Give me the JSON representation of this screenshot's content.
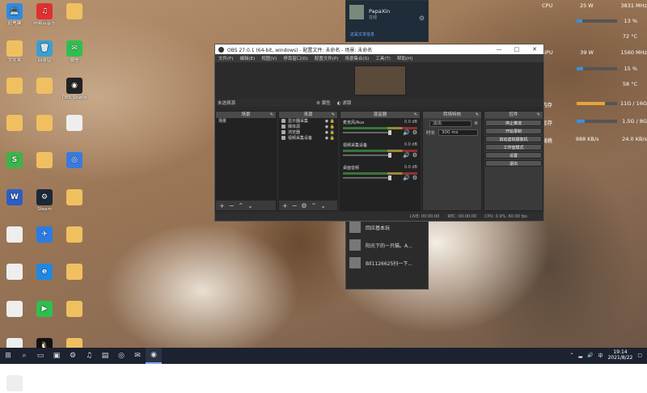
{
  "desktop": {
    "icons": [
      {
        "label": "此电脑",
        "color": "#2e8be6",
        "glyph": "💻",
        "name": "this-pc"
      },
      {
        "label": "网易云音乐",
        "color": "#e03030",
        "glyph": "♫",
        "name": "netease-music"
      },
      {
        "label": "",
        "color": "#f0c060",
        "glyph": "",
        "name": "folder"
      },
      {
        "label": "文件夹",
        "color": "#f0c060",
        "glyph": "",
        "name": "folder"
      },
      {
        "label": "回收站",
        "color": "#3aa0d0",
        "glyph": "🗑",
        "name": "recycle-bin"
      },
      {
        "label": "微信",
        "color": "#2fbf4f",
        "glyph": "✉",
        "name": "wechat"
      },
      {
        "label": "",
        "color": "#f0c060",
        "glyph": "",
        "name": "folder"
      },
      {
        "label": "",
        "color": "#f0c060",
        "glyph": "",
        "name": "folder"
      },
      {
        "label": "OBS Studio",
        "color": "#222",
        "glyph": "◉",
        "name": "obs-studio"
      },
      {
        "label": "",
        "color": "#f0c060",
        "glyph": "",
        "name": "folder"
      },
      {
        "label": "",
        "color": "#f0c060",
        "glyph": "",
        "name": "folder"
      },
      {
        "label": "",
        "color": "#eeeeee",
        "glyph": "",
        "name": "file"
      },
      {
        "label": "",
        "color": "#3bb54a",
        "glyph": "S",
        "name": "app"
      },
      {
        "label": "",
        "color": "#f0c060",
        "glyph": "",
        "name": "folder"
      },
      {
        "label": "",
        "color": "#3a7ae0",
        "glyph": "◎",
        "name": "app"
      },
      {
        "label": "",
        "color": "#2b5fc6",
        "glyph": "W",
        "name": "word-doc"
      },
      {
        "label": "Steam",
        "color": "#1b2838",
        "glyph": "⚙",
        "name": "steam"
      },
      {
        "label": "",
        "color": "#f0c060",
        "glyph": "",
        "name": "folder"
      },
      {
        "label": "",
        "color": "#eeeeee",
        "glyph": "",
        "name": "file"
      },
      {
        "label": "",
        "color": "#2c7be5",
        "glyph": "✈",
        "name": "app"
      },
      {
        "label": "",
        "color": "#f0c060",
        "glyph": "",
        "name": "folder"
      },
      {
        "label": "",
        "color": "#eeeeee",
        "glyph": "",
        "name": "file"
      },
      {
        "label": "",
        "color": "#1e88e5",
        "glyph": "e",
        "name": "app"
      },
      {
        "label": "",
        "color": "#f0c060",
        "glyph": "",
        "name": "folder"
      },
      {
        "label": "",
        "color": "#eeeeee",
        "glyph": "",
        "name": "file"
      },
      {
        "label": "",
        "color": "#2fbf4f",
        "glyph": "▶",
        "name": "app"
      },
      {
        "label": "",
        "color": "#f0c060",
        "glyph": "",
        "name": "folder"
      },
      {
        "label": "",
        "color": "#eeeeee",
        "glyph": "",
        "name": "file"
      },
      {
        "label": "",
        "color": "#111",
        "glyph": "🐧",
        "name": "qq"
      },
      {
        "label": "",
        "color": "#f0c060",
        "glyph": "",
        "name": "folder"
      },
      {
        "label": "",
        "color": "#eeeeee",
        "glyph": "",
        "name": "file"
      }
    ]
  },
  "stats": {
    "cpu_label": "CPU",
    "cpu_power": "25 W",
    "cpu_clock": "3831 MHz",
    "cpu_util": "13 %",
    "cpu_util_value": 13,
    "cpu_temp": "72 °C",
    "gpu_label": "GPU",
    "gpu_power": "39 W",
    "gpu_clock": "1560 MHz",
    "gpu_util": "15 %",
    "gpu_util_value": 15,
    "gpu_temp": "58 °C",
    "ram_label": "内存",
    "ram_value": "11G / 16G",
    "ram_fill": 0.69,
    "vram_label": "显存",
    "vram_value": "1.5G / 8G",
    "vram_fill": 0.19,
    "net_label": "网络",
    "net_down": "988 KB/s",
    "net_up": "24.0 KB/s"
  },
  "notification": {
    "name": "PapaXin",
    "sub": "在线",
    "text": "这是文本信息"
  },
  "chat": {
    "items": [
      "回应基本玩",
      "阳光下的一只猫。A...",
      "BIl1126625扫一下..."
    ]
  },
  "obs": {
    "title": "OBS 27.0.1 (64-bit, windows) - 配置文件: 未命名 - 场景: 未命名",
    "menu": [
      "文件(F)",
      "编辑(E)",
      "视图(V)",
      "停靠窗口(D)",
      "配置文件(P)",
      "场景集合(S)",
      "工具(T)",
      "帮助(H)"
    ],
    "prev_label": "未选择源",
    "prev_props": "属性",
    "prev_filters": "滤镜",
    "docks": {
      "scenes": "场景",
      "sources": "来源",
      "mixer": "混音器",
      "transitions": "转场特效",
      "controls": "控件"
    },
    "scene_items": [
      "场景"
    ],
    "sources": [
      "显示器采集",
      "媒体源",
      "浏览器",
      "视频采集设备"
    ],
    "mixer": [
      {
        "name": "麦克风/Aux",
        "db": "0.0 dB"
      },
      {
        "name": "视频采集设备",
        "db": "0.0 dB"
      },
      {
        "name": "桌面音频",
        "db": "0.0 dB"
      }
    ],
    "transition": {
      "type": "淡出",
      "duration_label": "时长",
      "duration": "300 ms"
    },
    "controls": [
      "停止推流",
      "开始录制",
      "启动虚拟摄像机",
      "工作室模式",
      "设置",
      "退出"
    ],
    "status": {
      "live": "LIVE: 00:00:00",
      "rec": "REC: 00:00:00",
      "cpu": "CPU: 0.9%, 60.00 fps"
    }
  },
  "taskbar": {
    "time": "19:14",
    "date": "2021/8/22",
    "lang": "中"
  }
}
